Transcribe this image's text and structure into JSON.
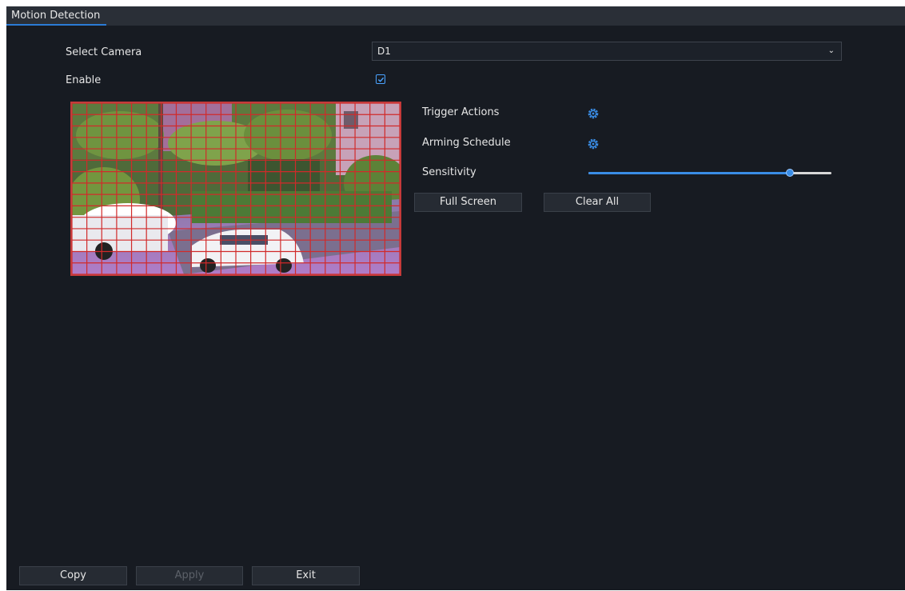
{
  "tab": {
    "title": "Motion Detection"
  },
  "form": {
    "select_camera_label": "Select Camera",
    "camera_value": "D1",
    "enable_label": "Enable",
    "enable_checked": true
  },
  "settings": {
    "trigger_actions_label": "Trigger Actions",
    "arming_schedule_label": "Arming Schedule",
    "sensitivity_label": "Sensitivity",
    "sensitivity_level": 0.83
  },
  "actions": {
    "full_screen_label": "Full Screen",
    "clear_all_label": "Clear All"
  },
  "footer": {
    "copy_label": "Copy",
    "apply_label": "Apply",
    "exit_label": "Exit"
  },
  "colors": {
    "accent": "#3a8de6",
    "grid": "#d12a2a",
    "background": "#171b22"
  },
  "icons": {
    "trigger_actions": "gear-icon",
    "arming_schedule": "gear-icon",
    "dropdown": "chevron-down-icon"
  }
}
